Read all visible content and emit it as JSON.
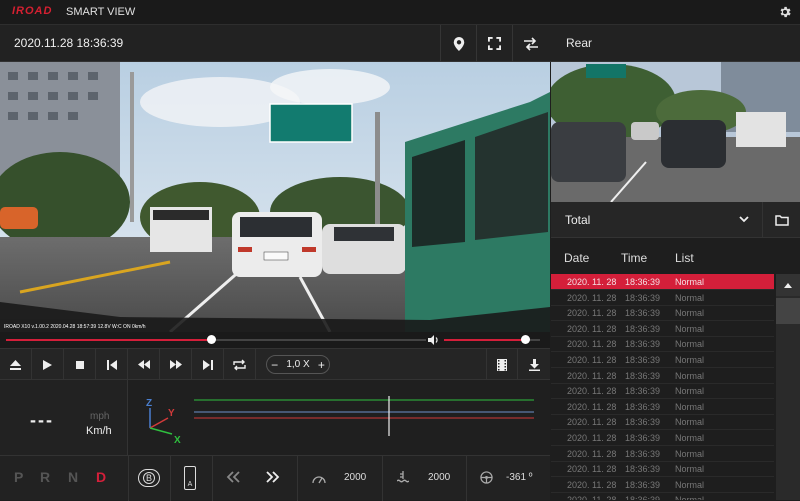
{
  "app": {
    "brand": "IROAD",
    "title": "SMART VIEW"
  },
  "header": {
    "datetime": "2020.11.28 18:36:39",
    "rear_label": "Rear"
  },
  "controls": {
    "speed": "1,0 X",
    "minus": "−",
    "plus": "+"
  },
  "telemetry": {
    "speed_value": "---",
    "unit_mph": "mph",
    "unit_kmh": "Km/h",
    "axes": {
      "x": "X",
      "y": "Y",
      "z": "Z"
    },
    "gears": [
      "P",
      "R",
      "N",
      "D"
    ],
    "active_gear": "D",
    "brake_label": "B",
    "auto_label": "A",
    "rpm": "2000",
    "value2": "2000",
    "angle": "-361 º"
  },
  "overlay_stamp": "IROAD X10  v.1.00.2  2020.04.28 18:57:39  12.8V  W:C ON  0km/h",
  "filter": {
    "selected": "Total"
  },
  "list": {
    "headers": {
      "date": "Date",
      "time": "Time",
      "list": "List"
    },
    "rows": [
      {
        "date": "2020. 11. 28",
        "time": "18:36:39",
        "type": "Normal"
      },
      {
        "date": "2020. 11. 28",
        "time": "18:36:39",
        "type": "Normal"
      },
      {
        "date": "2020. 11. 28",
        "time": "18:36:39",
        "type": "Normal"
      },
      {
        "date": "2020. 11. 28",
        "time": "18:36:39",
        "type": "Normal"
      },
      {
        "date": "2020. 11. 28",
        "time": "18:36:39",
        "type": "Normal"
      },
      {
        "date": "2020. 11. 28",
        "time": "18:36:39",
        "type": "Normal"
      },
      {
        "date": "2020. 11. 28",
        "time": "18:36:39",
        "type": "Normal"
      },
      {
        "date": "2020. 11. 28",
        "time": "18:36:39",
        "type": "Normal"
      },
      {
        "date": "2020. 11. 28",
        "time": "18:36:39",
        "type": "Normal"
      },
      {
        "date": "2020. 11. 28",
        "time": "18:36:39",
        "type": "Normal"
      },
      {
        "date": "2020. 11. 28",
        "time": "18:36:39",
        "type": "Normal"
      },
      {
        "date": "2020. 11. 28",
        "time": "18:36:39",
        "type": "Normal"
      },
      {
        "date": "2020. 11. 28",
        "time": "18:36:39",
        "type": "Normal"
      },
      {
        "date": "2020. 11. 28",
        "time": "18:36:39",
        "type": "Normal"
      },
      {
        "date": "2020. 11. 28",
        "time": "18:36:39",
        "type": "Normal"
      }
    ],
    "selected_index": 0
  },
  "playback": {
    "progress": 0.49,
    "volume": 0.85
  },
  "colors": {
    "accent": "#d41f3a",
    "brand": "#d42031"
  }
}
